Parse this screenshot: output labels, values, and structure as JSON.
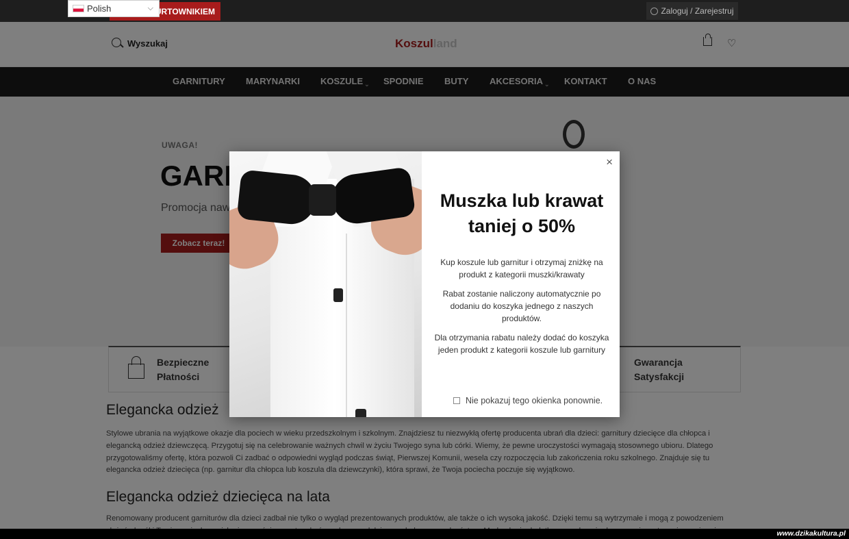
{
  "topbar": {
    "language": "Polish",
    "wholesale_label": "URTOWNIKIEM",
    "login_label": "Zaloguj / Zarejestruj"
  },
  "header": {
    "search_label": "Wyszukaj",
    "logo_part1": "Koszul",
    "logo_part2": "land"
  },
  "nav": {
    "items": [
      {
        "label": "GARNITURY"
      },
      {
        "label": "MARYNARKI"
      },
      {
        "label": "KOSZULE",
        "has_submenu": true
      },
      {
        "label": "SPODNIE"
      },
      {
        "label": "BUTY"
      },
      {
        "label": "AKCESORIA",
        "has_submenu": true
      },
      {
        "label": "KONTAKT"
      },
      {
        "label": "O NAS"
      }
    ]
  },
  "hero": {
    "eyebrow": "UWAGA!",
    "title": "GARN",
    "subtitle": "Promocja nawe",
    "cta_label": "Zobacz teraz!"
  },
  "features": {
    "left": "Bezpieczne Płatności",
    "right": "Gwarancja Satysfakcji"
  },
  "content": {
    "heading1": "Elegancka odzież",
    "paragraph1": "Stylowe ubrania na wyjątkowe okazje dla pociech w wieku przedszkolnym i szkolnym. Znajdziesz tu niezwykłą ofertę producenta ubrań dla dzieci: garnitury dziecięce dla chłopca i elegancką odzież dziewczęcą. Przygotuj się na celebrowanie ważnych chwil w życiu Twojego syna lub córki. Wiemy, że pewne uroczystości wymagają stosownego ubioru. Dlatego przygotowaliśmy ofertę, która pozwoli Ci zadbać o odpowiedni wygląd podczas świąt, Pierwszej Komunii, wesela czy rozpoczęcia lub zakończenia roku szkolnego. Znajduje się tu elegancka odzież dziecięca (np. garnitur dla chłopca lub koszula dla dziewczynki), która sprawi, że Twoja pociecha poczuje się wyjątkowo.",
    "heading2": "Elegancka odzież dziecięca na lata",
    "paragraph2": "Renomowany producent garniturów dla dzieci zadbał nie tylko o wygląd prezentowanych produktów, ale także o ich wysoką jakość. Dzięki temu są wytrzymałe i mogą z powodzeniem służyć, dopóki Twoja pociecha z nich nie wyrośnie, a potem być przekazane dalej, np. młodszemu rodzeństwu. Modne kroje dodatkowo zachęcają do noszenia, zatem nie musisz się"
  },
  "modal": {
    "close_symbol": "×",
    "title_line1": "Muszka lub krawat",
    "title_line2": "taniej o 50%",
    "text1": "Kup koszule lub garnitur i otrzymaj zniżkę na produkt z kategorii muszki/krawaty",
    "text2": "Rabat zostanie naliczony automatycznie po dodaniu do koszyka jednego z naszych produktów.",
    "text3": "Dla otrzymania rabatu należy dodać do koszyka jeden produkt z kategorii koszule lub garnitury",
    "checkbox_label": "Nie pokazuj tego okienka ponownie."
  },
  "watermark": "www.dzikakultura.pl",
  "colors": {
    "accent": "#a81c1c",
    "nav_bg": "#1a1a1a",
    "topbar_bg": "#1e1e1e"
  }
}
